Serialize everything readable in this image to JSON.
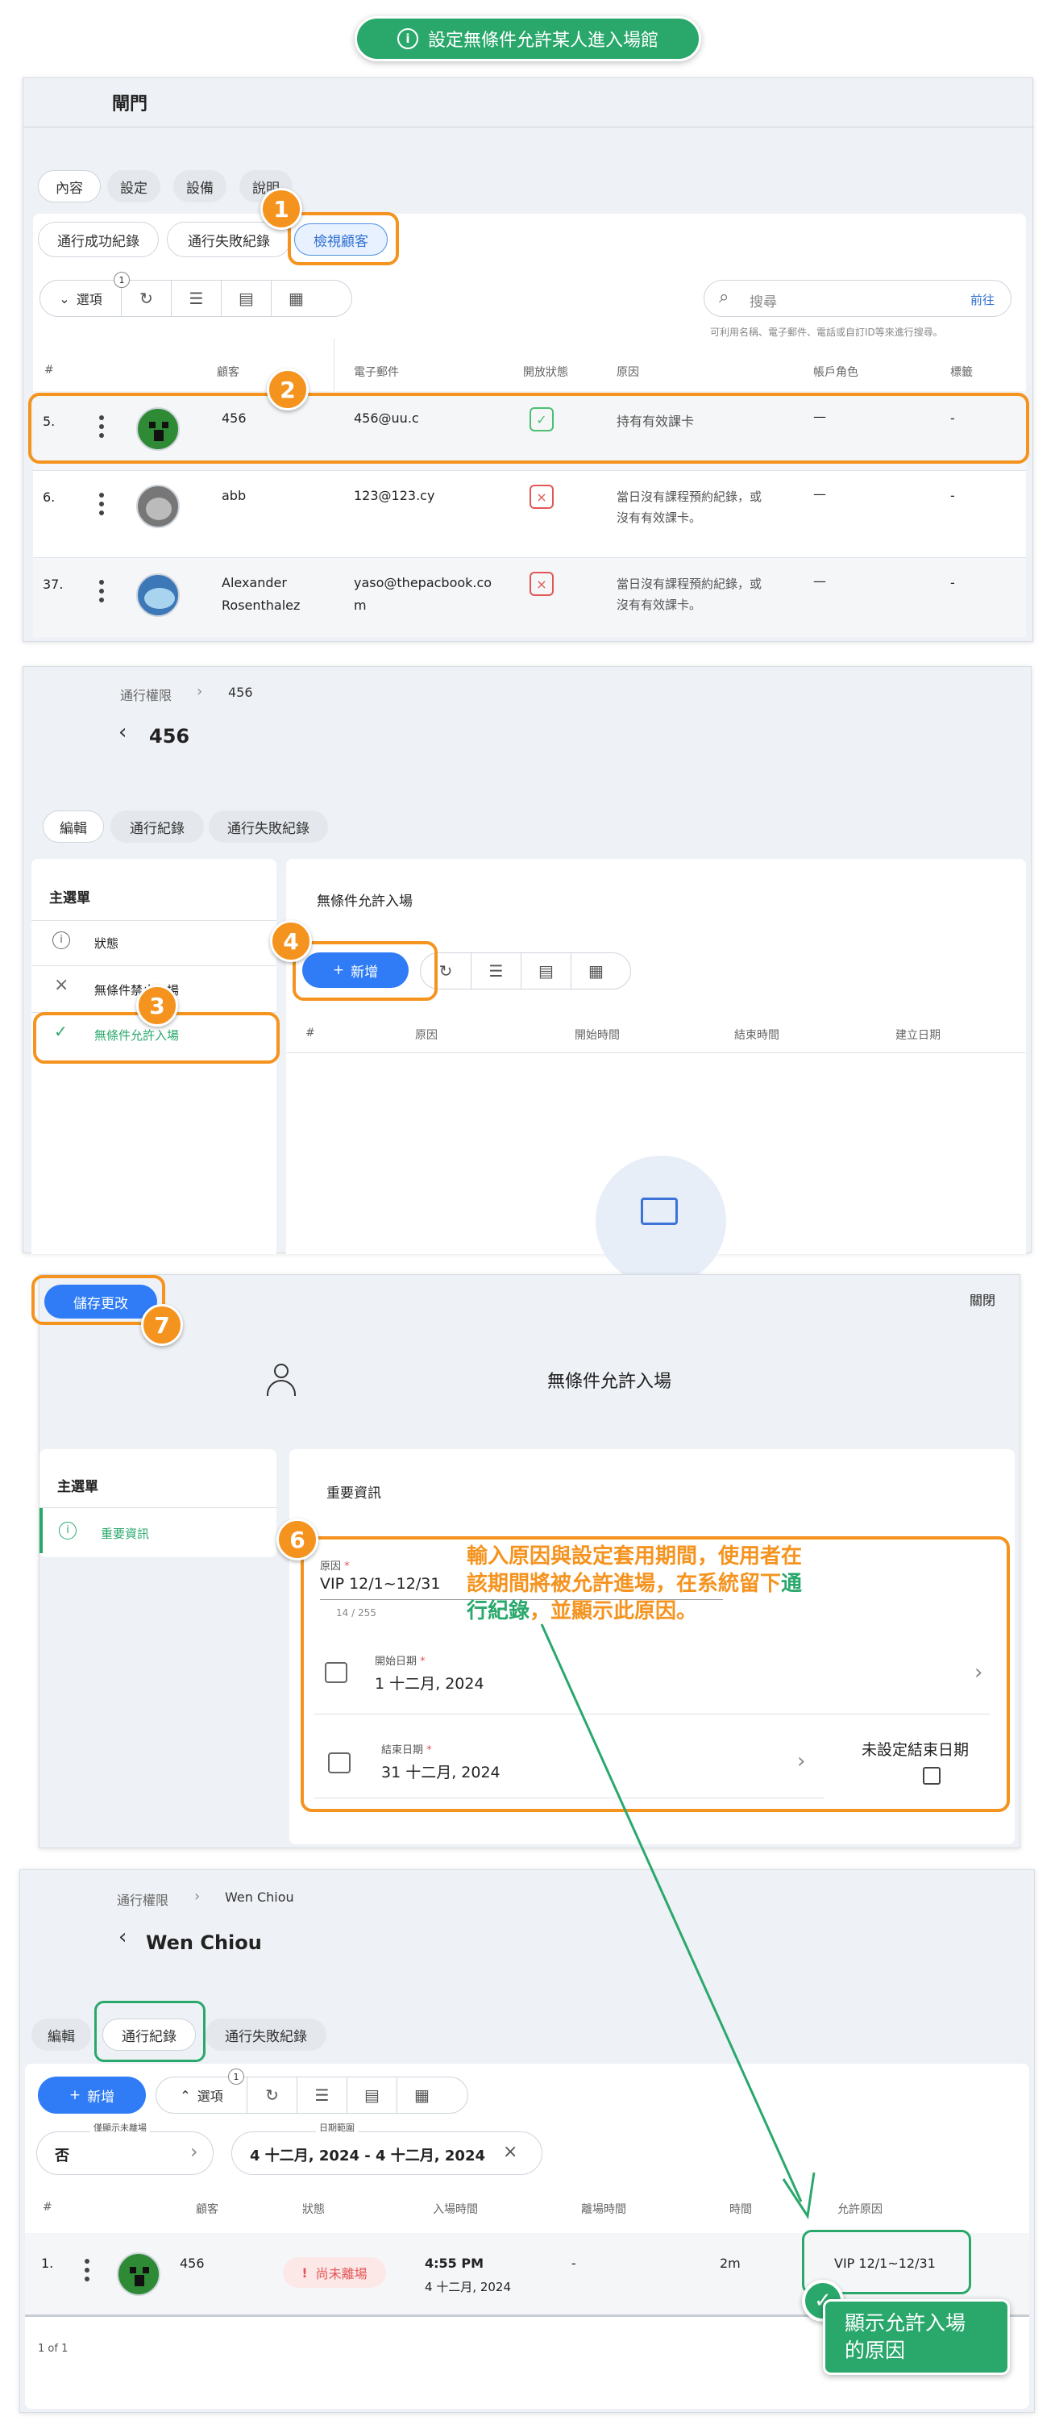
{
  "banner": {
    "title": "設定無條件允許某人進入場館",
    "icon": "info-icon"
  },
  "p1": {
    "title": "閘門",
    "tabs": [
      "內容",
      "設定",
      "設備",
      "說明"
    ],
    "subtabs": [
      "通行成功紀錄",
      "通行失敗紀錄",
      "檢視顧客"
    ],
    "options_label": "選項",
    "options_count": "1",
    "search": {
      "placeholder": "搜尋",
      "go": "前往",
      "hint": "可利用名稱、電子郵件、電話或自訂ID等來進行搜尋。"
    },
    "headers": [
      "#",
      "顧客",
      "電子郵件",
      "開放狀態",
      "原因",
      "帳戶角色",
      "標籤"
    ],
    "rows": [
      {
        "num": "5.",
        "name": "456",
        "email": "456@uu.c",
        "reason": "持有有效課卡",
        "role": "—",
        "tag": "-",
        "status": "ok"
      },
      {
        "num": "6.",
        "name": "abb",
        "email": "123@123.cy",
        "reason": "當日沒有課程預約紀錄，或沒有有效課卡。",
        "reason1": "當日沒有課程預約紀錄，或",
        "reason2": "沒有有效課卡。",
        "role": "—",
        "tag": "-",
        "status": "no"
      },
      {
        "num": "37.",
        "name1": "Alexander",
        "name2": "Rosenthalez",
        "email1": "yaso@thepacbook.co",
        "email2": "m",
        "reason1": "當日沒有課程預約紀錄，或",
        "reason2": "沒有有效課卡。",
        "role": "—",
        "tag": "-",
        "status": "no"
      }
    ]
  },
  "p2": {
    "breadcrumb": [
      "通行權限",
      "456"
    ],
    "title": "456",
    "tabs": [
      "編輯",
      "通行紀錄",
      "通行失敗紀錄"
    ],
    "menu_title": "主選單",
    "menu": [
      "狀態",
      "無條件禁止入場",
      "無條件允許入場"
    ],
    "section_title": "無條件允許入場",
    "add": "新增",
    "headers": [
      "#",
      "原因",
      "開始時間",
      "結束時間",
      "建立日期"
    ]
  },
  "p3": {
    "save": "儲存更改",
    "close": "關閉",
    "title": "無條件允許入場",
    "menu_title": "主選單",
    "menu_item": "重要資訊",
    "section": "重要資訊",
    "reason_label": "原因",
    "reason_value": "VIP 12/1~12/31",
    "reason_count": "14 / 255",
    "start_label": "開始日期",
    "start_value": "1 十二月, 2024",
    "end_label": "結束日期",
    "end_value": "31 十二月, 2024",
    "no_end": "未設定結束日期",
    "note_line1": "輸入原因與設定套用期間，使用者在",
    "note_line2": "該期間將被允許進場，在系統留下",
    "note_green1": "通",
    "note_green2": "行紀錄",
    "note_line3": "，並顯示此原因。"
  },
  "p4": {
    "breadcrumb": [
      "通行權限",
      "Wen Chiou"
    ],
    "title": "Wen Chiou",
    "tabs": [
      "編輯",
      "通行紀錄",
      "通行失敗紀錄"
    ],
    "add": "新增",
    "options_label": "選項",
    "options_count": "1",
    "filter1_label": "僅顯示未離場",
    "filter1_value": "否",
    "filter2_label": "日期範圍",
    "filter2_value": "4 十二月, 2024 - 4 十二月, 2024",
    "headers": [
      "#",
      "顧客",
      "狀態",
      "入場時間",
      "離場時間",
      "時間",
      "允許原因"
    ],
    "row": {
      "num": "1.",
      "name": "456",
      "status": "尚未離場",
      "time": "4:55 PM",
      "date": "4 十二月, 2024",
      "exit": "-",
      "duration": "2m",
      "reason": "VIP 12/1~12/31"
    },
    "pager": "1 of 1",
    "callout1": "顯示允許入場",
    "callout2": "的原因"
  },
  "colors": {
    "orange": "#f5931f",
    "green": "#2aa86c",
    "blue": "#2f7cf6"
  }
}
